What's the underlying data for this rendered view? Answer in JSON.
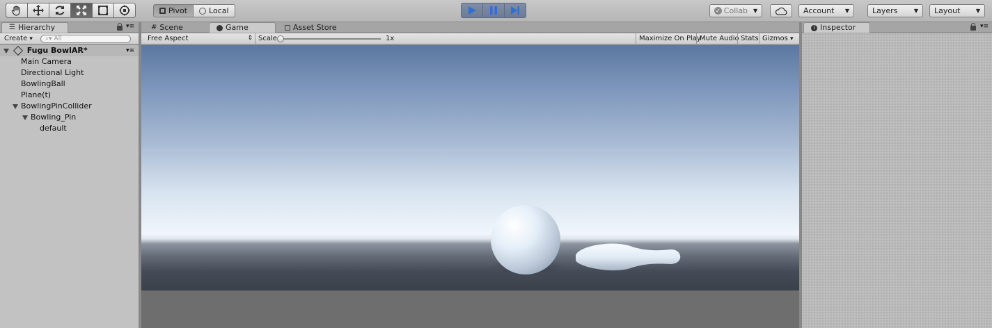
{
  "toolbar": {
    "tools": [
      "hand-tool",
      "move-tool",
      "rotate-tool",
      "scale-tool",
      "rect-tool",
      "transform-tool"
    ],
    "active_tool": "scale-tool",
    "pivot_label": "Pivot",
    "local_label": "Local",
    "collab_label": "Collab",
    "account_label": "Account",
    "layers_label": "Layers",
    "layout_label": "Layout"
  },
  "hierarchy": {
    "tab_label": "Hierarchy",
    "create_label": "Create",
    "search_placeholder": "All",
    "scene_name": "Fugu BowlAR*",
    "items": [
      {
        "label": "Main Camera",
        "depth": 1
      },
      {
        "label": "Directional Light",
        "depth": 1
      },
      {
        "label": "BowlingBall",
        "depth": 1
      },
      {
        "label": "Plane(t)",
        "depth": 1
      },
      {
        "label": "BowlingPinCollider",
        "depth": 1,
        "expanded": true
      },
      {
        "label": "Bowling_Pin",
        "depth": 2,
        "expanded": true
      },
      {
        "label": "default",
        "depth": 3
      }
    ]
  },
  "center": {
    "tabs": {
      "scene": "Scene",
      "game": "Game",
      "asset_store": "Asset Store"
    },
    "active_tab": "Game",
    "aspect_label": "Free Aspect",
    "scale_label": "Scale",
    "scale_value": "1x",
    "maximize_label": "Maximize On Play",
    "mute_label": "Mute Audio",
    "stats_label": "Stats",
    "gizmos_label": "Gizmos"
  },
  "inspector": {
    "tab_label": "Inspector"
  },
  "colors": {
    "play_accent": "#2f6fd6",
    "sky_top": "#5b78a0",
    "horizon": "#f0f6fb",
    "ground": "#3a414b",
    "ball": "#e8f1fb"
  }
}
